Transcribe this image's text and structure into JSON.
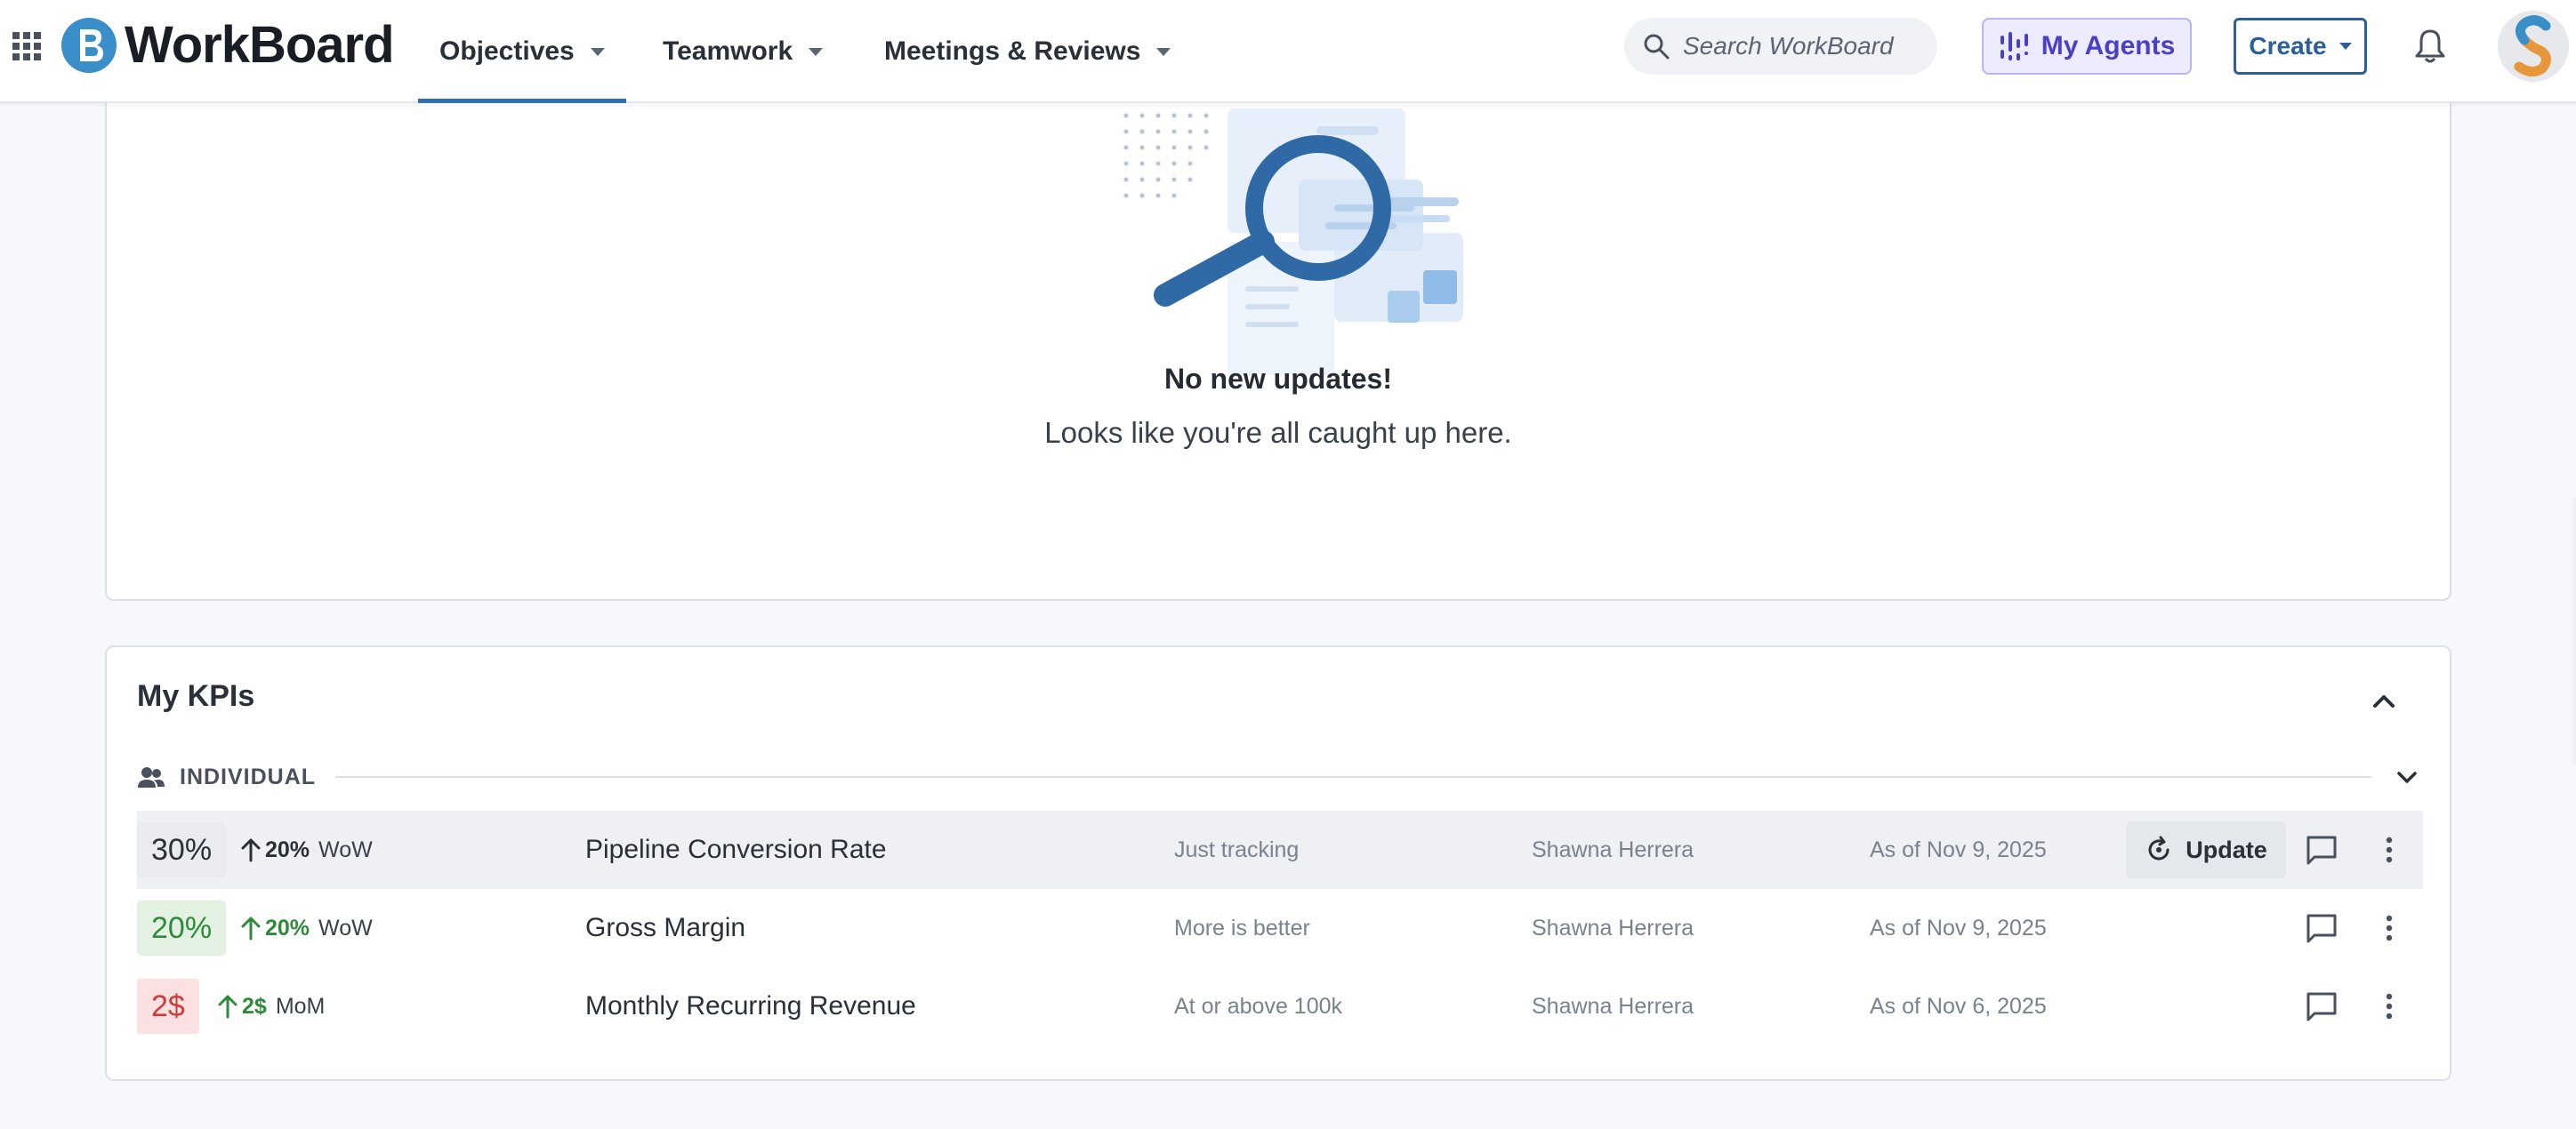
{
  "app": {
    "logo_text": "WorkBoard",
    "brand_color": "#2f6db5"
  },
  "nav": {
    "items": [
      {
        "label": "Objectives",
        "active": true
      },
      {
        "label": "Teamwork",
        "active": false
      },
      {
        "label": "Meetings & Reviews",
        "active": false
      }
    ],
    "search_placeholder": "Search WorkBoard",
    "agents_label": "My Agents",
    "create_label": "Create"
  },
  "updates": {
    "empty_title": "No new updates!",
    "empty_subtitle": "Looks like you're all caught up here."
  },
  "kpis": {
    "title": "My KPIs",
    "group_label": "INDIVIDUAL",
    "update_label": "Update",
    "rows": [
      {
        "value": "30%",
        "value_status": "neutral",
        "delta": "20%",
        "period": "WoW",
        "name": "Pipeline Conversion Rate",
        "target": "Just tracking",
        "owner": "Shawna Herrera",
        "date": "As of Nov 9, 2025"
      },
      {
        "value": "20%",
        "value_status": "good",
        "delta": "20%",
        "period": "WoW",
        "name": "Gross Margin",
        "target": "More is better",
        "owner": "Shawna Herrera",
        "date": "As of Nov 9, 2025"
      },
      {
        "value": "2$",
        "value_status": "bad",
        "delta": "2$",
        "period": "MoM",
        "name": "Monthly Recurring Revenue",
        "target": "At or above 100k",
        "owner": "Shawna Herrera",
        "date": "As of Nov 6, 2025"
      }
    ]
  },
  "colors": {
    "neutral_bg": "#e9ebef",
    "neutral_fg": "#2a2f38",
    "good_bg": "#e3f1e3",
    "good_fg": "#2f8a3a",
    "bad_bg": "#fbe1e1",
    "bad_fg": "#d23b3b",
    "trend_up": "#2f8a3a"
  }
}
